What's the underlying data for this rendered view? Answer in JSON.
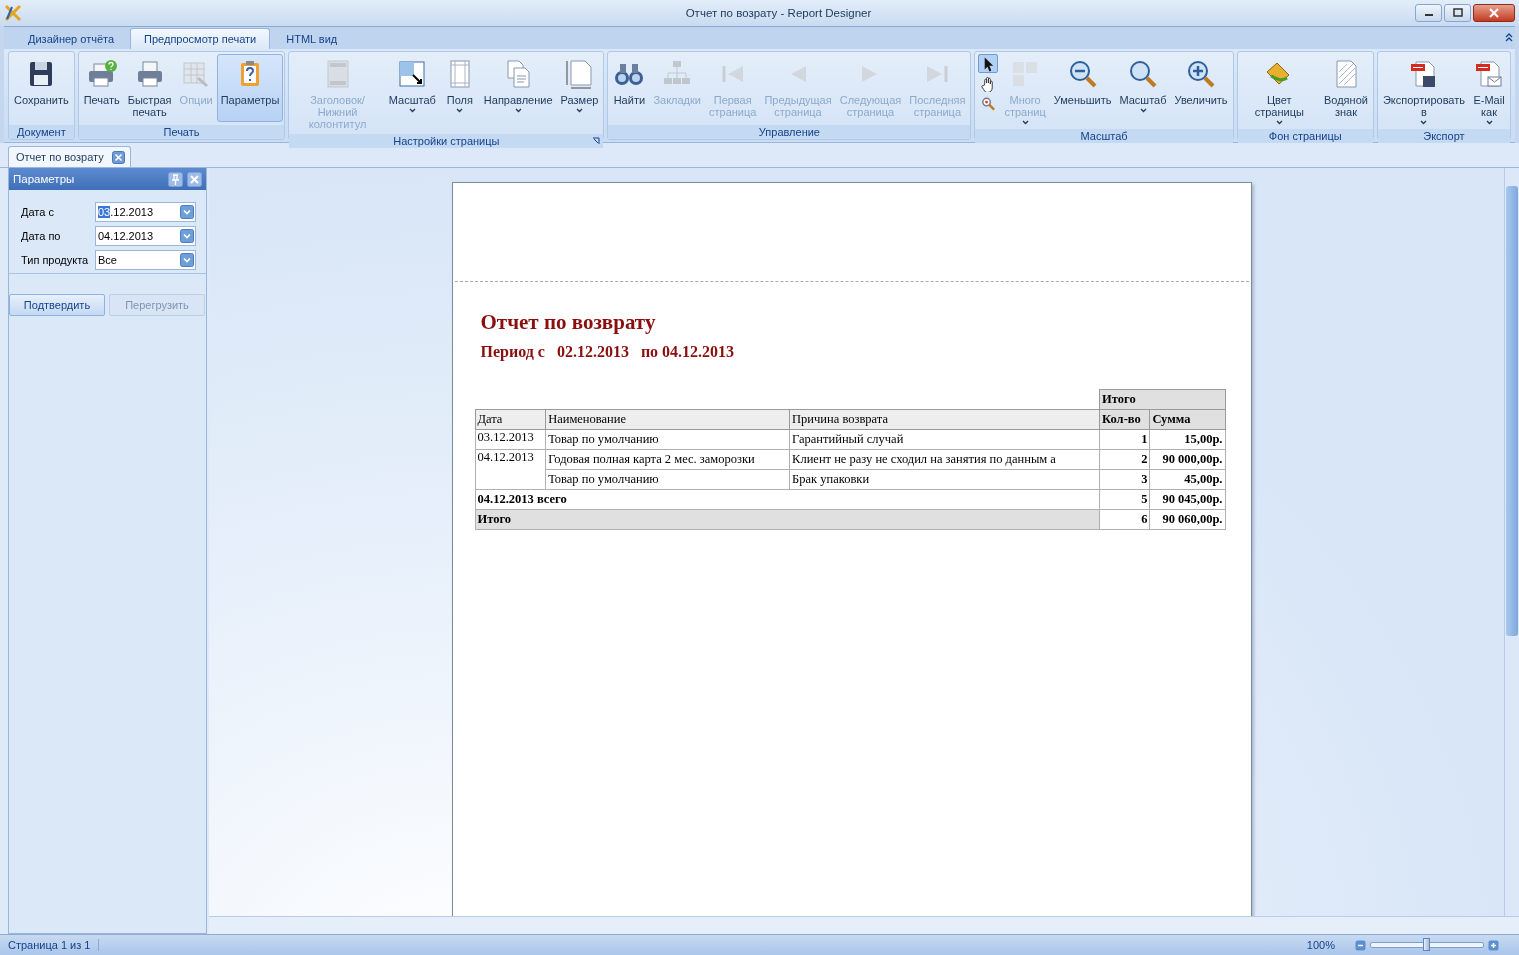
{
  "window": {
    "title": "Отчет по возрату - Report Designer"
  },
  "tabs": [
    {
      "label": "Дизайнер отчёта",
      "selected": false
    },
    {
      "label": "Предпросмотр печати",
      "selected": true
    },
    {
      "label": "HTML вид",
      "selected": false
    }
  ],
  "ribbon": {
    "groups": [
      {
        "label": "Документ",
        "buttons": [
          {
            "label": "Сохранить",
            "disabled": false,
            "selected": false,
            "dropdown": false
          }
        ]
      },
      {
        "label": "Печать",
        "buttons": [
          {
            "label": "Печать",
            "disabled": false,
            "selected": false,
            "dropdown": false
          },
          {
            "label": "Быстрая\nпечать",
            "disabled": false,
            "selected": false,
            "dropdown": false
          },
          {
            "label": "Опции",
            "disabled": true,
            "selected": false,
            "dropdown": false
          },
          {
            "label": "Параметры",
            "disabled": false,
            "selected": true,
            "dropdown": false
          }
        ]
      },
      {
        "label": "Настройки страницы",
        "launcher": true,
        "buttons": [
          {
            "label": "Заголовок/Нижний\nколонтитул",
            "disabled": true,
            "selected": false,
            "dropdown": false
          },
          {
            "label": "Масштаб",
            "disabled": false,
            "selected": false,
            "dropdown": true
          },
          {
            "label": "Поля",
            "disabled": false,
            "selected": false,
            "dropdown": true
          },
          {
            "label": "Направление",
            "disabled": false,
            "selected": false,
            "dropdown": true
          },
          {
            "label": "Размер",
            "disabled": false,
            "selected": false,
            "dropdown": true
          }
        ]
      },
      {
        "label": "Управление",
        "buttons": [
          {
            "label": "Найти",
            "disabled": false,
            "selected": false,
            "dropdown": false
          },
          {
            "label": "Закладки",
            "disabled": true,
            "selected": false,
            "dropdown": false
          },
          {
            "label": "Первая\nстраница",
            "disabled": true,
            "selected": false,
            "dropdown": false
          },
          {
            "label": "Предыдущая\nстраница",
            "disabled": true,
            "selected": false,
            "dropdown": false
          },
          {
            "label": "Следующая\nстраница",
            "disabled": true,
            "selected": false,
            "dropdown": false
          },
          {
            "label": "Последняя\nстраница",
            "disabled": true,
            "selected": false,
            "dropdown": false
          }
        ]
      },
      {
        "label": "Масштаб",
        "tools": [
          {
            "kind": "pointer",
            "selected": true
          },
          {
            "kind": "hand",
            "selected": false
          },
          {
            "kind": "magnifier",
            "selected": false
          }
        ],
        "buttons": [
          {
            "label": "Много\nстраниц",
            "disabled": true,
            "selected": false,
            "dropdown": true
          },
          {
            "label": "Уменьшить",
            "disabled": false,
            "selected": false,
            "dropdown": false
          },
          {
            "label": "Масштаб",
            "disabled": false,
            "selected": false,
            "dropdown": true
          },
          {
            "label": "Увеличить",
            "disabled": false,
            "selected": false,
            "dropdown": false
          }
        ]
      },
      {
        "label": "Фон страницы",
        "buttons": [
          {
            "label": "Цвет страницы",
            "disabled": false,
            "selected": false,
            "dropdown": true
          },
          {
            "label": "Водяной\nзнак",
            "disabled": false,
            "selected": false,
            "dropdown": false
          }
        ]
      },
      {
        "label": "Экспорт",
        "buttons": [
          {
            "label": "Экспортировать\nв",
            "disabled": false,
            "selected": false,
            "dropdown": true
          },
          {
            "label": "E-Mail\nкак",
            "disabled": false,
            "selected": false,
            "dropdown": true
          }
        ]
      }
    ]
  },
  "document_tab": {
    "label": "Отчет по возрату"
  },
  "parameters": {
    "title": "Параметры",
    "fields": [
      {
        "label": "Дата с",
        "selected_text": "03",
        "value": ".12.2013"
      },
      {
        "label": "Дата по",
        "value": "04.12.2013"
      },
      {
        "label": "Тип продукта",
        "value": "Все"
      }
    ],
    "buttons": [
      {
        "label": "Подтвердить",
        "disabled": false
      },
      {
        "label": "Перегрузить",
        "disabled": true
      }
    ]
  },
  "report": {
    "title": "Отчет по возврату",
    "period": "Период с   02.12.2013   по 04.12.2013",
    "group_header": "Итого",
    "columns": [
      "Дата",
      "Наименование",
      "Причина возврата",
      "Кол-во",
      "Сумма"
    ],
    "rows": [
      {
        "kind": "data",
        "date": "03.12.2013",
        "items": [
          {
            "name": "Товар по умолчанию",
            "reason": "Гарантийный случай",
            "qty": "1",
            "sum": "15,00р."
          }
        ]
      },
      {
        "kind": "data",
        "date": "04.12.2013",
        "items": [
          {
            "name": "Годовая полная карта 2 мес. заморозки",
            "reason": "Клиент не разу не сходил на занятия по данным а",
            "qty": "2",
            "sum": "90 000,00р."
          },
          {
            "name": "Товар по умолчанию",
            "reason": "Брак упаковки",
            "qty": "3",
            "sum": "45,00р."
          }
        ]
      },
      {
        "kind": "subtotal",
        "label": "04.12.2013 всего",
        "qty": "5",
        "sum": "90 045,00р."
      },
      {
        "kind": "total",
        "label": "Итого",
        "qty": "6",
        "sum": "90 060,00р."
      }
    ]
  },
  "status_bar": {
    "page": "Страница 1 из 1",
    "zoom": "100%",
    "zoom_slider": {
      "level": 0.5
    }
  }
}
